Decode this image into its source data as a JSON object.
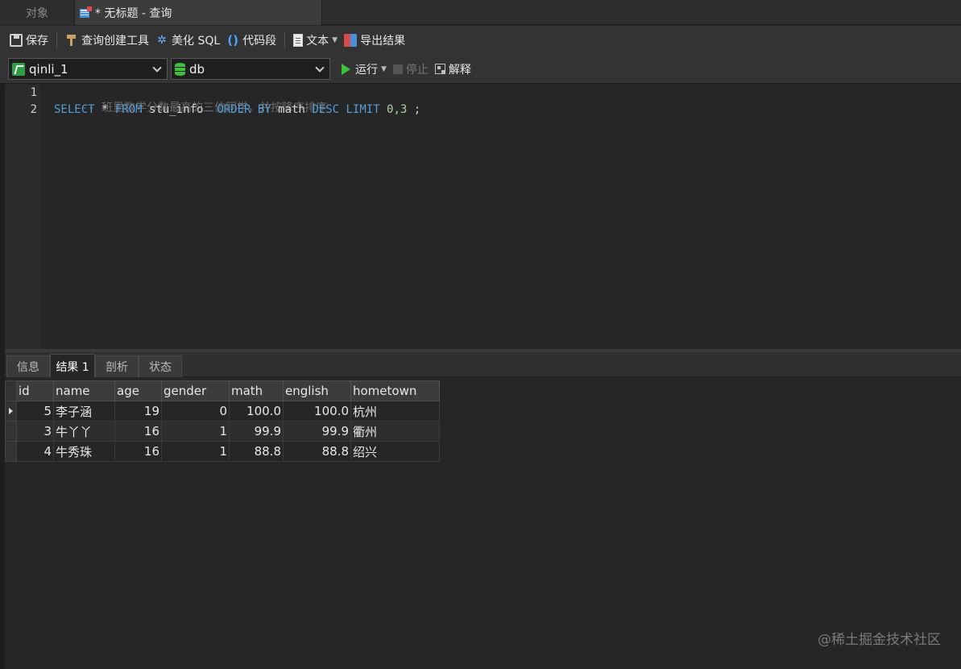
{
  "tabs": {
    "objects": "对象",
    "query": "* 无标题 - 查询"
  },
  "toolbar1": {
    "save": "保存",
    "query_builder": "查询创建工具",
    "beautify_sql": "美化 SQL",
    "code_snippet": "代码段",
    "text": "文本",
    "export": "导出结果"
  },
  "toolbar2": {
    "connection": "qinli_1",
    "database": "db",
    "run": "运行",
    "stop": "停止",
    "explain": "解释"
  },
  "editor": {
    "line_numbers": [
      "1",
      "2"
    ],
    "line1_comment": "-- 班里数学分数最高的三位同学，并按降序排序",
    "line2": {
      "select": "SELECT",
      "star": " * ",
      "from": "FROM",
      "table": " stu_info  ",
      "order_by": "ORDER BY",
      "col": " math ",
      "desc": "DESC",
      "limit": " LIMIT",
      "limit_vals": " 0,3",
      "semicolon": " ;"
    }
  },
  "result_tabs": [
    "信息",
    "结果 1",
    "剖析",
    "状态"
  ],
  "grid": {
    "columns": [
      "id",
      "name",
      "age",
      "gender",
      "math",
      "english",
      "hometown"
    ],
    "rows": [
      [
        "5",
        "李子涵",
        "19",
        "0",
        "100.0",
        "100.0",
        "杭州"
      ],
      [
        "3",
        "牛丫丫",
        "16",
        "1",
        "99.9",
        "99.9",
        "衢州"
      ],
      [
        "4",
        "牛秀珠",
        "16",
        "1",
        "88.8",
        "88.8",
        "绍兴"
      ]
    ]
  },
  "watermark": "@稀土掘金技术社区"
}
